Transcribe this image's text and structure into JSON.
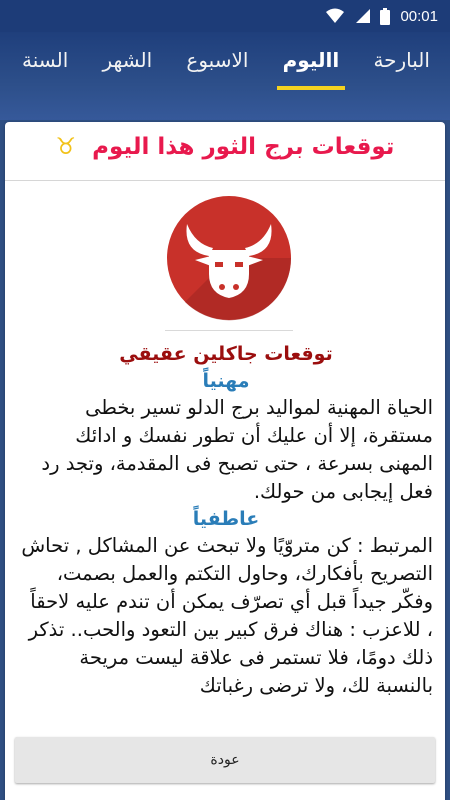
{
  "status_bar": {
    "time": "00:01",
    "icons": [
      "wifi-icon",
      "signal-icon",
      "battery-icon"
    ]
  },
  "tabs": [
    {
      "label": "البارحة"
    },
    {
      "label": "االيوم"
    },
    {
      "label": "الاسبوع"
    },
    {
      "label": "الشهر"
    },
    {
      "label": "السنة"
    }
  ],
  "active_tab_index": 1,
  "card": {
    "title": "توقعات برج الثور هذا اليوم",
    "sign_glyph": "♉",
    "author": "توقعات جاكلين عقيقي",
    "sections": [
      {
        "heading": "مهنياً",
        "text": "الحياة المهنية لمواليد برج الدلو تسير بخطى مستقرة، إلا أن عليك أن تطور نفسك و ادائك المهنى بسرعة ، حتى تصبح فى المقدمة، وتجد رد فعل إيجابى من حولك."
      },
      {
        "heading": "عاطفياً",
        "text": "المرتبط : كن متروّيًا ولا تبحث عن المشاكل , تحاش التصريح بأفكارك، وحاول التكتم والعمل بصمت، وفكّر جيداً قبل أي تصرّف يمكن أن تندم عليه لاحقاً ، للاعزب : هناك فرق كبير بين التعود والحب.. تذكر ذلك دومًا، فلا تستمر فى علاقة ليست مريحة بالنسبة لك، ولا ترضى رغباتك"
      }
    ]
  },
  "back_button": {
    "label": "عودة"
  },
  "colors": {
    "app_bar": "#2d4f8a",
    "tab_indicator": "#f4d21f",
    "title": "#e8194d",
    "author": "#9b0e0e",
    "section_heading": "#2a7db8",
    "logo_circle": "#c8312a"
  }
}
